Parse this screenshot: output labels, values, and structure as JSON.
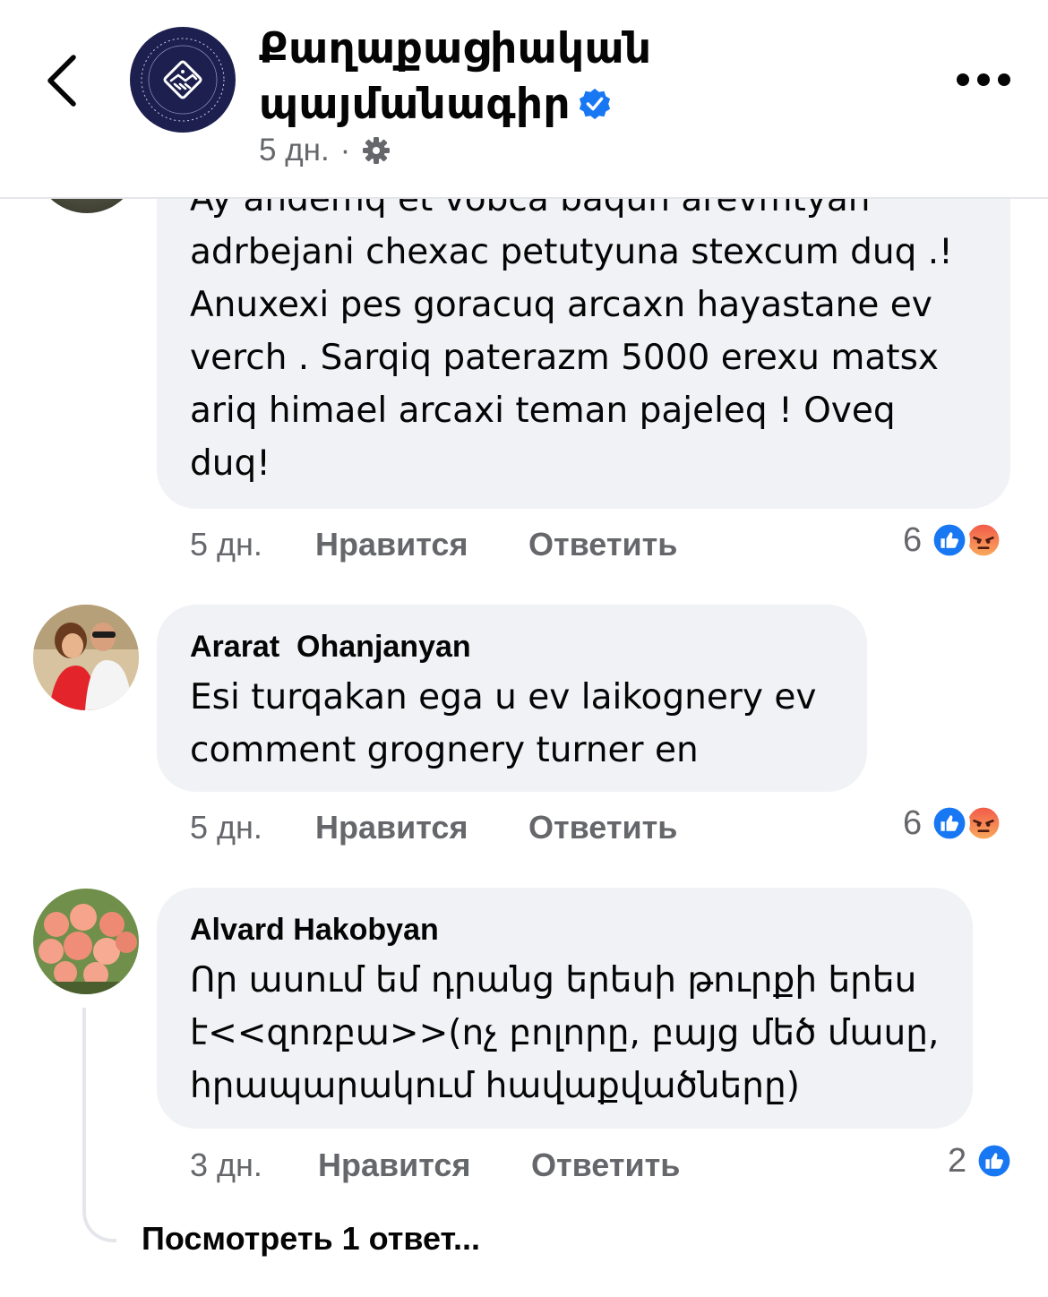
{
  "header": {
    "page_name_line1": "Քաղաքացիական",
    "page_name_line2": "պայմանագիր",
    "post_time": "5 дн.",
    "separator": "·",
    "privacy_icon": "gear-icon",
    "back_icon": "chevron-left-icon",
    "menu_icon": "more-horizontal-icon"
  },
  "comments": [
    {
      "author": "",
      "text": "Ay andemq et vobca baqun arevmtyan\nadrbejani chexac petutyuna stexcum duq .!\nAnuxexi pes goracuq arcaxn hayastane ev\nverch . Sarqiq paterazm 5000 erexu matsx\nariq himael arcaxi teman pajeleq ! Oveq\nduq!",
      "time": "5 дн.",
      "like_label": "Нравится",
      "reply_label": "Ответить",
      "reaction_count": "6",
      "reactions": [
        "like",
        "angry"
      ]
    },
    {
      "author": "Ararat  Ohanjanyan",
      "text": "Esi turqakan ega u ev laikognery ev\ncomment grognery turner en",
      "time": "5 дн.",
      "like_label": "Нравится",
      "reply_label": "Ответить",
      "reaction_count": "6",
      "reactions": [
        "like",
        "angry"
      ]
    },
    {
      "author": "Alvard Hakobyan",
      "text": "Որ ասում եմ դրանց երեսի թուրքի երես\nէ<<զոռբա>>(ոչ բոլորը, բայց մեծ մասը,\nհրապարակում հավաքվածները)",
      "time": "3 дн.",
      "like_label": "Нравится",
      "reply_label": "Ответить",
      "reaction_count": "2",
      "reactions": [
        "like"
      ]
    }
  ],
  "view_replies_label": "Посмотреть 1 ответ...",
  "colors": {
    "like_blue": "#1877f2",
    "angry_orange": "#f7714c",
    "bubble_bg": "#f0f2f5",
    "secondary_text": "#65676b",
    "avatar_navy": "#1d1f4f"
  }
}
